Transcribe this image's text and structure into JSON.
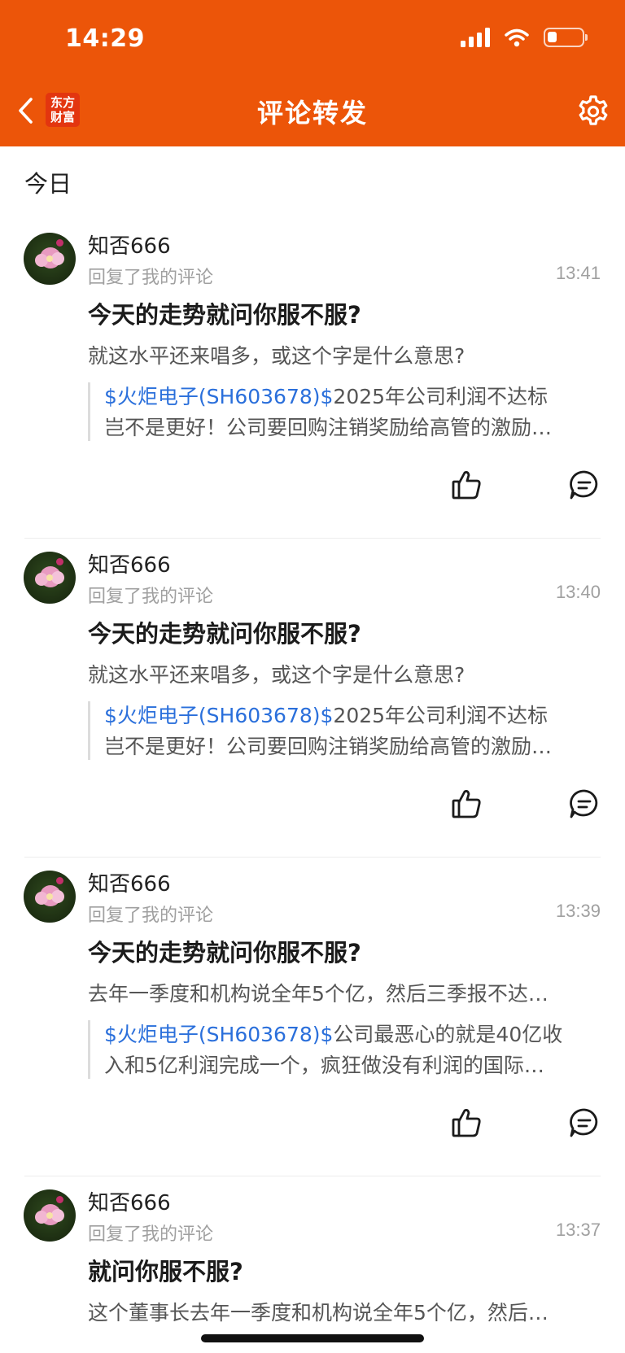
{
  "status_bar": {
    "time": "14:29"
  },
  "header": {
    "title": "评论转发",
    "logo_line1": "东方",
    "logo_line2": "财富"
  },
  "section_label": "今日",
  "colors": {
    "header_bg": "#EC5509",
    "link": "#2a6fdb"
  },
  "icons": {
    "back": "chevron-left-icon",
    "settings": "gear-icon",
    "like": "thumbs-up-icon",
    "comment": "comment-bubble-icon"
  },
  "items": [
    {
      "username": "知否666",
      "subtitle": "回复了我的评论",
      "time": "13:41",
      "title": "今天的走势就问你服不服?",
      "reply": "就这水平还来唱多，或这个字是什么意思?",
      "quote_tag": "$火炬电子(SH603678)$",
      "quote_line1_rest": "2025年公司利润不达标",
      "quote_line2": "岂不是更好！公司要回购注销奖励给高管的激励…"
    },
    {
      "username": "知否666",
      "subtitle": "回复了我的评论",
      "time": "13:40",
      "title": "今天的走势就问你服不服?",
      "reply": "就这水平还来唱多，或这个字是什么意思?",
      "quote_tag": "$火炬电子(SH603678)$",
      "quote_line1_rest": "2025年公司利润不达标",
      "quote_line2": "岂不是更好！公司要回购注销奖励给高管的激励…"
    },
    {
      "username": "知否666",
      "subtitle": "回复了我的评论",
      "time": "13:39",
      "title": "今天的走势就问你服不服?",
      "reply": "去年一季度和机构说全年5个亿，然后三季报不达…",
      "quote_tag": "$火炬电子(SH603678)$",
      "quote_line1_rest": "公司最恶心的就是40亿收",
      "quote_line2": "入和5亿利润完成一个，疯狂做没有利润的国际…"
    },
    {
      "username": "知否666",
      "subtitle": "回复了我的评论",
      "time": "13:37",
      "title": "就问你服不服?",
      "reply": "这个董事长去年一季度和机构说全年5个亿，然后…"
    }
  ]
}
